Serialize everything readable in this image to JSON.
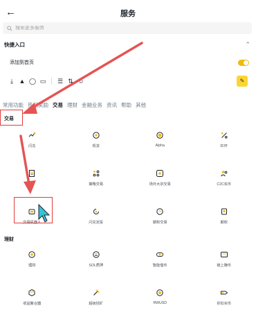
{
  "header": {
    "back_icon": "back-arrow-icon",
    "title": "服务"
  },
  "search": {
    "placeholder": "搜索更多服务"
  },
  "quick_entry": {
    "label": "快捷入口",
    "home_label": "添加到首页",
    "home_enabled": true
  },
  "shortcuts": [
    "download-icon",
    "tower-icon",
    "parachute-icon",
    "card-icon",
    "list-icon",
    "transfer-icon",
    "users-icon"
  ],
  "tabs": [
    {
      "label": "常用功能",
      "active": false
    },
    {
      "label": "热门奖励",
      "active": false
    },
    {
      "label": "交易",
      "active": true
    },
    {
      "label": "理财",
      "active": false
    },
    {
      "label": "金融业务",
      "active": false
    },
    {
      "label": "资讯",
      "active": false
    },
    {
      "label": "帮助",
      "active": false
    },
    {
      "label": "其他",
      "active": false
    }
  ],
  "sections": {
    "trade": {
      "title": "交易",
      "items": [
        {
          "label": "闪兑",
          "icon": "convert-icon"
        },
        {
          "label": "现货",
          "icon": "spot-icon"
        },
        {
          "label": "Alpha",
          "icon": "alpha-icon"
        },
        {
          "label": "杠杆",
          "icon": "margin-icon"
        },
        {
          "label": "",
          "icon": "document-icon"
        },
        {
          "label": "策略交易",
          "icon": "strategy-icon"
        },
        {
          "label": "场外大宗交易",
          "icon": "otc-icon"
        },
        {
          "label": "C2C买币",
          "icon": "c2c-icon"
        },
        {
          "label": "交易机器人",
          "icon": "bot-icon"
        },
        {
          "label": "闪兑定投",
          "icon": "recurring-icon"
        },
        {
          "label": "期权交易",
          "icon": "options-icon"
        },
        {
          "label": "期权",
          "icon": "wallet-icon"
        }
      ]
    },
    "earn": {
      "title": "理财",
      "items": [
        {
          "label": "理财",
          "icon": "earn-icon"
        },
        {
          "label": "SOL质押",
          "icon": "sol-icon"
        },
        {
          "label": "智能借币",
          "icon": "loan-icon"
        },
        {
          "label": "链上赚币",
          "icon": "onchain-icon"
        },
        {
          "label": "收益聚合器",
          "icon": "box-icon"
        },
        {
          "label": "超级挖矿",
          "icon": "mining-icon"
        },
        {
          "label": "RWUSD",
          "icon": "rwusd-icon"
        },
        {
          "label": "折扣买币",
          "icon": "tag-icon"
        }
      ]
    }
  },
  "colors": {
    "accent": "#f0b90b",
    "annotation": "#e23b3b",
    "text": "#1e2329"
  }
}
